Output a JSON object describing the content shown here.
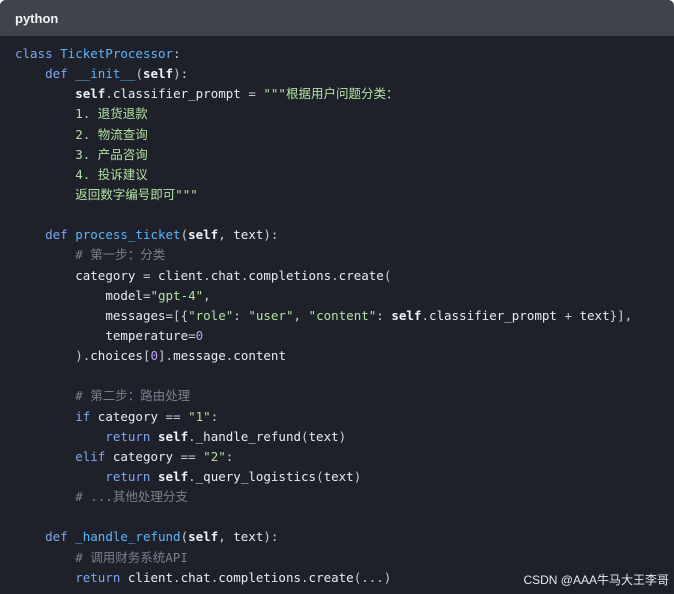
{
  "header": {
    "language": "python"
  },
  "code_lines": [
    [
      {
        "t": "class ",
        "c": "kw"
      },
      {
        "t": "TicketProcessor",
        "c": "def"
      },
      {
        "t": ":",
        "c": "op"
      }
    ],
    [
      {
        "t": "    def ",
        "c": "kw"
      },
      {
        "t": "__init__",
        "c": "def"
      },
      {
        "t": "(",
        "c": "op"
      },
      {
        "t": "self",
        "c": "self"
      },
      {
        "t": "):",
        "c": "op"
      }
    ],
    [
      {
        "t": "        ",
        "c": "op"
      },
      {
        "t": "self",
        "c": "self"
      },
      {
        "t": ".",
        "c": "op"
      },
      {
        "t": "classifier_prompt",
        "c": "ident"
      },
      {
        "t": " = ",
        "c": "op"
      },
      {
        "t": "\"\"\"根据用户问题分类：",
        "c": "str"
      }
    ],
    [
      {
        "t": "        1. 退货退款",
        "c": "str"
      }
    ],
    [
      {
        "t": "        2. 物流查询",
        "c": "str"
      }
    ],
    [
      {
        "t": "        3. 产品咨询",
        "c": "str"
      }
    ],
    [
      {
        "t": "        4. 投诉建议",
        "c": "str"
      }
    ],
    [
      {
        "t": "        返回数字编号即可\"\"\"",
        "c": "str"
      }
    ],
    [],
    [
      {
        "t": "    def ",
        "c": "kw"
      },
      {
        "t": "process_ticket",
        "c": "def"
      },
      {
        "t": "(",
        "c": "op"
      },
      {
        "t": "self",
        "c": "self"
      },
      {
        "t": ", ",
        "c": "op"
      },
      {
        "t": "text",
        "c": "ident"
      },
      {
        "t": "):",
        "c": "op"
      }
    ],
    [
      {
        "t": "        # 第一步：分类",
        "c": "cm"
      }
    ],
    [
      {
        "t": "        ",
        "c": "op"
      },
      {
        "t": "category",
        "c": "ident"
      },
      {
        "t": " = ",
        "c": "op"
      },
      {
        "t": "client",
        "c": "ident"
      },
      {
        "t": ".",
        "c": "op"
      },
      {
        "t": "chat",
        "c": "ident"
      },
      {
        "t": ".",
        "c": "op"
      },
      {
        "t": "completions",
        "c": "ident"
      },
      {
        "t": ".",
        "c": "op"
      },
      {
        "t": "create",
        "c": "ident"
      },
      {
        "t": "(",
        "c": "op"
      }
    ],
    [
      {
        "t": "            ",
        "c": "op"
      },
      {
        "t": "model",
        "c": "ident"
      },
      {
        "t": "=",
        "c": "op"
      },
      {
        "t": "\"gpt-4\"",
        "c": "str"
      },
      {
        "t": ",",
        "c": "op"
      }
    ],
    [
      {
        "t": "            ",
        "c": "op"
      },
      {
        "t": "messages",
        "c": "ident"
      },
      {
        "t": "=[{",
        "c": "op"
      },
      {
        "t": "\"role\"",
        "c": "str"
      },
      {
        "t": ": ",
        "c": "op"
      },
      {
        "t": "\"user\"",
        "c": "str"
      },
      {
        "t": ", ",
        "c": "op"
      },
      {
        "t": "\"content\"",
        "c": "str"
      },
      {
        "t": ": ",
        "c": "op"
      },
      {
        "t": "self",
        "c": "self"
      },
      {
        "t": ".",
        "c": "op"
      },
      {
        "t": "classifier_prompt",
        "c": "ident"
      },
      {
        "t": " + ",
        "c": "op"
      },
      {
        "t": "text",
        "c": "ident"
      },
      {
        "t": "}],",
        "c": "op"
      }
    ],
    [
      {
        "t": "            ",
        "c": "op"
      },
      {
        "t": "temperature",
        "c": "ident"
      },
      {
        "t": "=",
        "c": "op"
      },
      {
        "t": "0",
        "c": "num"
      }
    ],
    [
      {
        "t": "        ).",
        "c": "op"
      },
      {
        "t": "choices",
        "c": "ident"
      },
      {
        "t": "[",
        "c": "op"
      },
      {
        "t": "0",
        "c": "num"
      },
      {
        "t": "].",
        "c": "op"
      },
      {
        "t": "message",
        "c": "ident"
      },
      {
        "t": ".",
        "c": "op"
      },
      {
        "t": "content",
        "c": "ident"
      }
    ],
    [],
    [
      {
        "t": "        # 第二步：路由处理",
        "c": "cm"
      }
    ],
    [
      {
        "t": "        if ",
        "c": "kw"
      },
      {
        "t": "category",
        "c": "ident"
      },
      {
        "t": " == ",
        "c": "op"
      },
      {
        "t": "\"1\"",
        "c": "str"
      },
      {
        "t": ":",
        "c": "op"
      }
    ],
    [
      {
        "t": "            return ",
        "c": "kw"
      },
      {
        "t": "self",
        "c": "self"
      },
      {
        "t": ".",
        "c": "op"
      },
      {
        "t": "_handle_refund",
        "c": "ident"
      },
      {
        "t": "(",
        "c": "op"
      },
      {
        "t": "text",
        "c": "ident"
      },
      {
        "t": ")",
        "c": "op"
      }
    ],
    [
      {
        "t": "        elif ",
        "c": "kw"
      },
      {
        "t": "category",
        "c": "ident"
      },
      {
        "t": " == ",
        "c": "op"
      },
      {
        "t": "\"2\"",
        "c": "str"
      },
      {
        "t": ":",
        "c": "op"
      }
    ],
    [
      {
        "t": "            return ",
        "c": "kw"
      },
      {
        "t": "self",
        "c": "self"
      },
      {
        "t": ".",
        "c": "op"
      },
      {
        "t": "_query_logistics",
        "c": "ident"
      },
      {
        "t": "(",
        "c": "op"
      },
      {
        "t": "text",
        "c": "ident"
      },
      {
        "t": ")",
        "c": "op"
      }
    ],
    [
      {
        "t": "        # ...其他处理分支",
        "c": "cm"
      }
    ],
    [],
    [
      {
        "t": "    def ",
        "c": "kw"
      },
      {
        "t": "_handle_refund",
        "c": "def"
      },
      {
        "t": "(",
        "c": "op"
      },
      {
        "t": "self",
        "c": "self"
      },
      {
        "t": ", ",
        "c": "op"
      },
      {
        "t": "text",
        "c": "ident"
      },
      {
        "t": "):",
        "c": "op"
      }
    ],
    [
      {
        "t": "        # 调用财务系统API",
        "c": "cm"
      }
    ],
    [
      {
        "t": "        return ",
        "c": "kw"
      },
      {
        "t": "client",
        "c": "ident"
      },
      {
        "t": ".",
        "c": "op"
      },
      {
        "t": "chat",
        "c": "ident"
      },
      {
        "t": ".",
        "c": "op"
      },
      {
        "t": "completions",
        "c": "ident"
      },
      {
        "t": ".",
        "c": "op"
      },
      {
        "t": "create",
        "c": "ident"
      },
      {
        "t": "(...)",
        "c": "op"
      }
    ]
  ],
  "watermark": "CSDN @AAA牛马大王李哥"
}
